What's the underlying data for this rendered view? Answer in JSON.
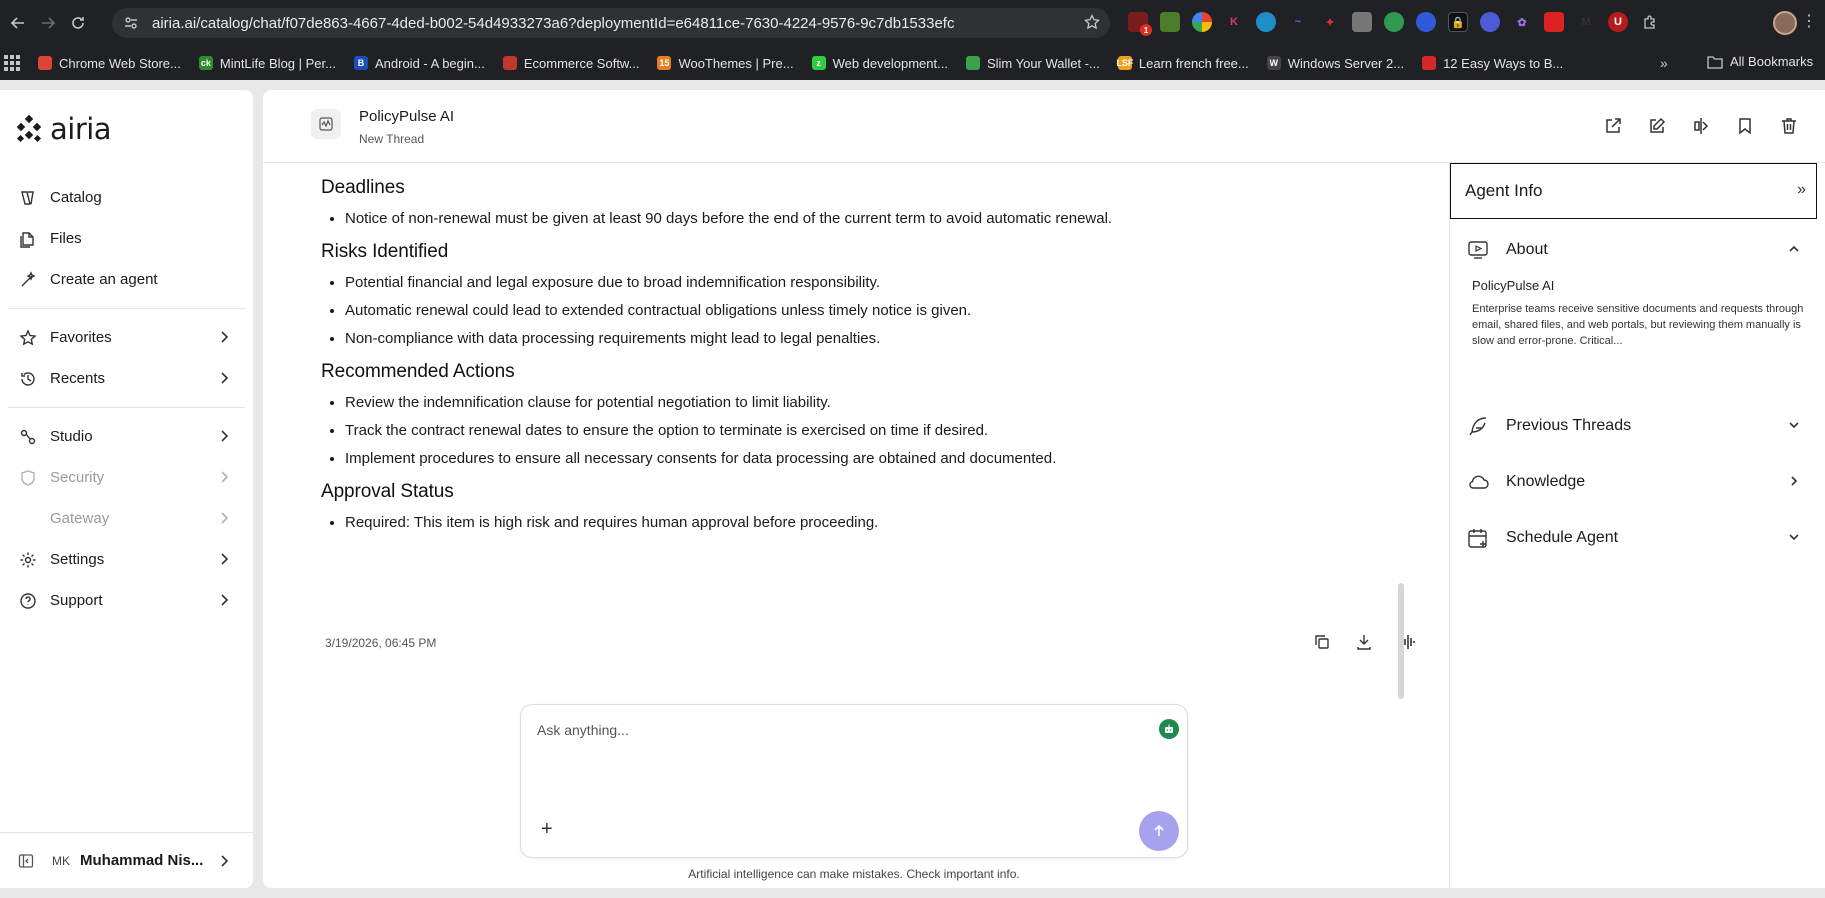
{
  "browser": {
    "url": "airia.ai/catalog/chat/f07de863-4667-4ded-b002-54d4933273a6?deploymentId=e64811ce-7630-4224-9576-9c7db1533efc",
    "bookmarks": [
      {
        "label": "Chrome Web Store...",
        "color": "#db4437",
        "glyph": ""
      },
      {
        "label": "MintLife Blog | Per...",
        "color": "#2e8b2e",
        "glyph": "ck"
      },
      {
        "label": "Android - A begin...",
        "color": "#1a4fb5",
        "glyph": "B"
      },
      {
        "label": "Ecommerce Softw...",
        "color": "#c0392b",
        "glyph": ""
      },
      {
        "label": "WooThemes | Pre...",
        "color": "#e67e22",
        "glyph": "15"
      },
      {
        "label": "Web development...",
        "color": "#2ecc40",
        "glyph": "z"
      },
      {
        "label": "Slim Your Wallet -...",
        "color": "#3aa34a",
        "glyph": ""
      },
      {
        "label": "Learn french free...",
        "color": "#f0a020",
        "glyph": "LSF"
      },
      {
        "label": "Windows Server 2...",
        "color": "#444444",
        "glyph": "W"
      },
      {
        "label": "12 Easy Ways to B...",
        "color": "#d62828",
        "glyph": ""
      }
    ],
    "all_bookmarks_label": "All Bookmarks",
    "extension_badge": "1"
  },
  "sidebar": {
    "logo_text": "airia",
    "items": [
      {
        "label": "Catalog",
        "icon": "catalog-icon"
      },
      {
        "label": "Files",
        "icon": "files-icon"
      },
      {
        "label": "Create an agent",
        "icon": "create-agent-icon"
      },
      {
        "label": "Favorites",
        "icon": "favorites-icon"
      },
      {
        "label": "Recents",
        "icon": "recents-icon"
      },
      {
        "label": "Studio",
        "icon": "studio-icon"
      },
      {
        "label": "Security",
        "icon": "security-icon"
      },
      {
        "label": "Gateway",
        "icon": "gateway-icon"
      },
      {
        "label": "Settings",
        "icon": "settings-icon"
      },
      {
        "label": "Support",
        "icon": "support-icon"
      }
    ],
    "user": {
      "initials": "MK",
      "name": "Muhammad Nis..."
    }
  },
  "header": {
    "agent_name": "PolicyPulse AI",
    "thread_name": "New Thread"
  },
  "message": {
    "sections": [
      {
        "heading": "Deadlines",
        "bullets": [
          "Notice of non-renewal must be given at least 90 days before the end of the current term to avoid automatic renewal."
        ]
      },
      {
        "heading": "Risks Identified",
        "bullets": [
          "Potential financial and legal exposure due to broad indemnification responsibility.",
          "Automatic renewal could lead to extended contractual obligations unless timely notice is given.",
          "Non-compliance with data processing requirements might lead to legal penalties."
        ]
      },
      {
        "heading": "Recommended Actions",
        "bullets": [
          "Review the indemnification clause for potential negotiation to limit liability.",
          "Track the contract renewal dates to ensure the option to terminate is exercised on time if desired.",
          "Implement procedures to ensure all necessary consents for data processing are obtained and documented."
        ]
      },
      {
        "heading": "Approval Status",
        "bullets": [
          "Required: This item is high risk and requires human approval before proceeding."
        ]
      }
    ],
    "timestamp": "3/19/2026, 06:45 PM"
  },
  "composer": {
    "placeholder": "Ask anything...",
    "disclaimer": "Artificial intelligence can make mistakes. Check important info."
  },
  "right_panel": {
    "title": "Agent Info",
    "about_label": "About",
    "about_name": "PolicyPulse AI",
    "about_desc": "Enterprise teams receive sensitive documents and requests through email, shared files, and web portals, but reviewing them manually is slow and error-prone. Critical...",
    "previous_threads_label": "Previous Threads",
    "knowledge_label": "Knowledge",
    "schedule_label": "Schedule Agent"
  },
  "colors": {
    "send_button": "#a7a2ee",
    "bot_badge": "#1e8a50"
  }
}
